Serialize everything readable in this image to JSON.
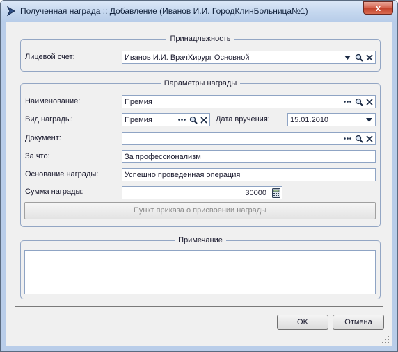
{
  "window": {
    "title": "Полученная награда :: Добавление  (Иванов И.И. ГородКлинБольница№1)",
    "close_label": "x"
  },
  "belonging": {
    "legend": "Принадлежность",
    "account_label": "Лицевой счет:",
    "account_value": "Иванов И.И. ВрачХирург Основной"
  },
  "params": {
    "legend": "Параметры награды",
    "name_label": "Наименование:",
    "name_value": "Премия",
    "type_label": "Вид награды:",
    "type_value": "Премия",
    "date_label": "Дата вручения:",
    "date_value": "15.01.2010",
    "document_label": "Документ:",
    "document_value": "",
    "for_what_label": "За что:",
    "for_what_value": "За профессионализм",
    "basis_label": "Основание награды:",
    "basis_value": "Успешно проведенная операция",
    "amount_label": "Сумма награды:",
    "amount_value": "30000",
    "order_button": "Пункт приказа о присвоении награды"
  },
  "notes": {
    "legend": "Примечание",
    "value": ""
  },
  "footer": {
    "ok_label": "OK",
    "cancel_label": "Отмена"
  },
  "icons": {
    "window_icon": "app-arrow-icon",
    "dropdown": "chevron-down-icon",
    "search": "search-icon",
    "clear": "clear-x-icon",
    "ellipsis": "ellipsis-icon",
    "calculator": "calculator-icon"
  },
  "colors": {
    "titlebar": "#c3d6ee",
    "close_button": "#d4604a",
    "group_border": "#93a6c4",
    "field_border": "#8fa4c4"
  }
}
